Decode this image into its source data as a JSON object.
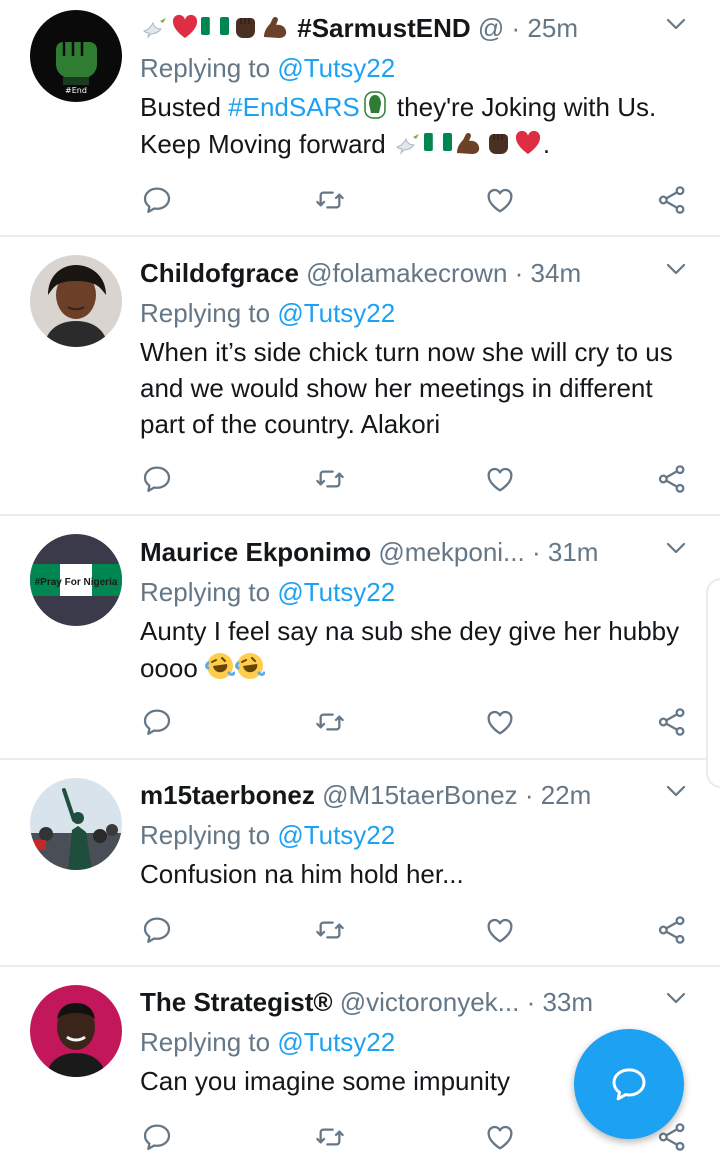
{
  "colors": {
    "accent": "#1da1f2",
    "muted": "#657786",
    "text": "#14171a",
    "divider": "#e6ecf0"
  },
  "tweets": [
    {
      "name_prefix_emoji": [
        "dove",
        "red-heart",
        "nigeria-flag",
        "raised-fist",
        "flexed-biceps"
      ],
      "name": "#SarmustEND",
      "handle": "@",
      "time": "25m",
      "replying_label": "Replying to",
      "replying_to": "@Tutsy22",
      "text_parts": [
        "Busted ",
        "#EndSARS",
        " they're Joking with Us. Keep Moving forward ",
        "."
      ],
      "avatar": "endsars-fist-avatar"
    },
    {
      "name": "Childofgrace",
      "handle": "@folamakecrown",
      "time": "34m",
      "replying_label": "Replying to",
      "replying_to": "@Tutsy22",
      "text": "When it’s side chick turn now she will  cry to us and we would show her meetings in different part of the country. Alakori",
      "avatar": "woman-portrait-avatar"
    },
    {
      "name": "Maurice Ekponimo",
      "handle": "@mekponi...",
      "time": "31m",
      "replying_label": "Replying to",
      "replying_to": "@Tutsy22",
      "text": "Aunty I feel say na sub she dey give her hubby oooo",
      "avatar_text": "#Pray For Nigeria",
      "avatar": "pray-for-nigeria-avatar"
    },
    {
      "name": "m15taerbonez",
      "handle": "@M15taerBonez",
      "time": "22m",
      "replying_label": "Replying to",
      "replying_to": "@Tutsy22",
      "text": "Confusion na him hold her...",
      "avatar": "protest-crowd-avatar"
    },
    {
      "name": "The Strategist®",
      "handle": "@victoronyek...",
      "time": "33m",
      "replying_label": "Replying to",
      "replying_to": "@Tutsy22",
      "text": "Can you imagine some impunity",
      "avatar": "man-portrait-avatar"
    }
  ],
  "icons": [
    "reply-icon",
    "retweet-icon",
    "like-icon",
    "share-icon",
    "chevron-down-icon",
    "compose-reply-icon"
  ]
}
